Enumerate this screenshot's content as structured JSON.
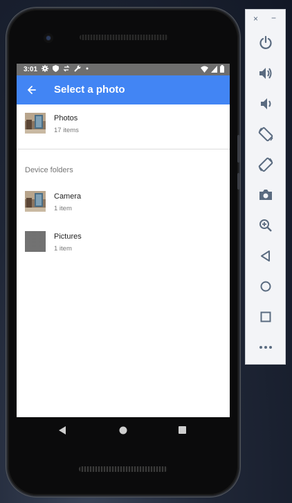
{
  "status_bar": {
    "time": "3:01"
  },
  "app_bar": {
    "title": "Select a photo"
  },
  "albums": [
    {
      "name": "Photos",
      "count": "17 items"
    }
  ],
  "section": {
    "label": "Device folders"
  },
  "folders": [
    {
      "name": "Camera",
      "count": "1 item"
    },
    {
      "name": "Pictures",
      "count": "1 item"
    }
  ],
  "emulator_panel": {
    "close_glyph": "×",
    "minimize_glyph": "−",
    "buttons": [
      "power-icon",
      "volume-up-icon",
      "volume-down-icon",
      "rotate-left-icon",
      "rotate-right-icon",
      "camera-screenshot-icon",
      "zoom-icon",
      "back-icon",
      "home-icon",
      "overview-icon",
      "more-icon"
    ]
  },
  "colors": {
    "app_bar": "#4285f4",
    "status_bar": "#6e6e6e",
    "panel_icon": "#5a6b80"
  }
}
